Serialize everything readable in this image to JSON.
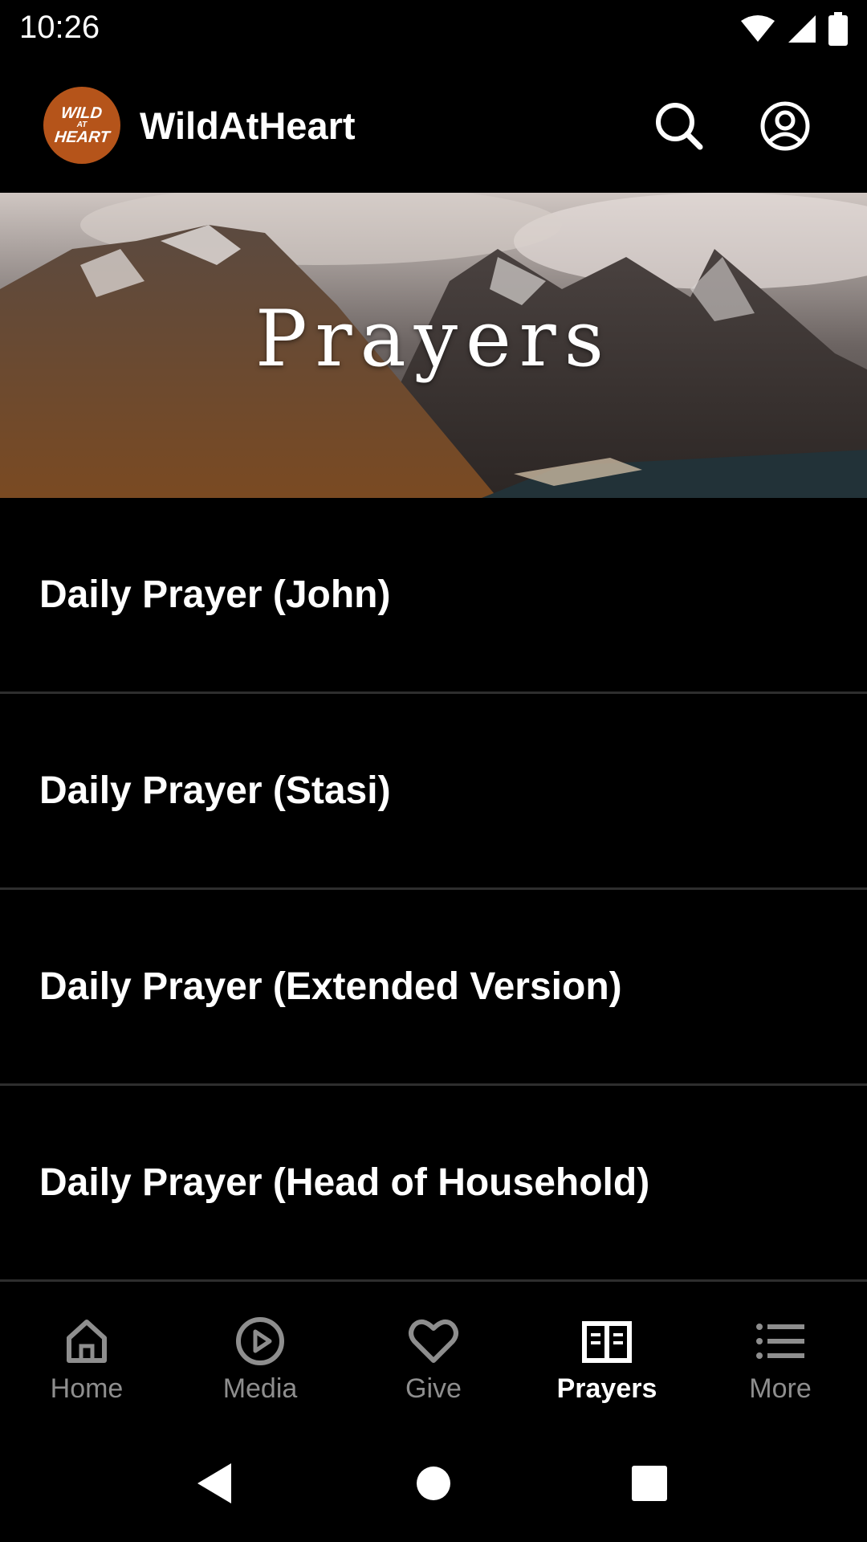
{
  "status_bar": {
    "time": "10:26"
  },
  "app_bar": {
    "logo_text": [
      "WILD",
      "AT",
      "HEART"
    ],
    "title": "WildAtHeart"
  },
  "hero": {
    "title": "Prayers"
  },
  "prayers": [
    {
      "label": "Daily Prayer (John)"
    },
    {
      "label": "Daily Prayer (Stasi)"
    },
    {
      "label": "Daily Prayer (Extended Version)"
    },
    {
      "label": "Daily Prayer (Head of Household)"
    }
  ],
  "bottom_nav": [
    {
      "label": "Home",
      "icon": "home-icon",
      "active": false
    },
    {
      "label": "Media",
      "icon": "play-circle-icon",
      "active": false
    },
    {
      "label": "Give",
      "icon": "heart-icon",
      "active": false
    },
    {
      "label": "Prayers",
      "icon": "open-book-icon",
      "active": true
    },
    {
      "label": "More",
      "icon": "list-icon",
      "active": false
    }
  ],
  "colors": {
    "background": "#000000",
    "logo": "#b5541a",
    "inactive_nav": "#8e8e8e",
    "active_nav": "#ffffff",
    "divider": "#2e2e2e"
  }
}
